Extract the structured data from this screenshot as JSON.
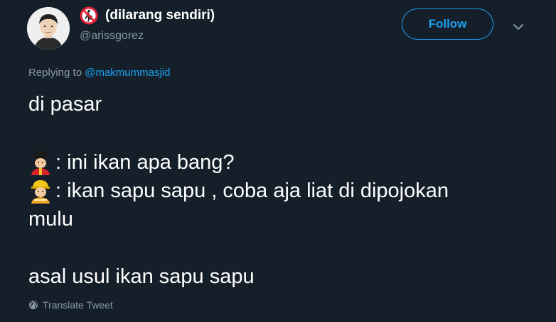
{
  "user": {
    "display_name": "(dilarang sendiri)",
    "handle": "@arissgorez",
    "name_emoji": "no-pedestrians-icon"
  },
  "actions": {
    "follow_label": "Follow",
    "more_icon": "chevron-down-icon"
  },
  "reply": {
    "prefix": "Replying to",
    "mention": "@makmummasjid"
  },
  "tweet": {
    "line1": "di pasar",
    "line2": ": ini ikan apa bang?",
    "line2_emoji": "guard-icon",
    "line3": ": ikan sapu sapu , coba aja liat di dipojokan",
    "line3_emoji": "construction-worker-icon",
    "line4": "mulu",
    "line5": "asal usul ikan sapu sapu"
  },
  "footer": {
    "translate_label": "Translate Tweet",
    "translate_icon": "globe-icon"
  },
  "colors": {
    "background": "#151f2a",
    "accent": "#1da1f2",
    "muted": "#8899a6",
    "text": "#ffffff"
  }
}
